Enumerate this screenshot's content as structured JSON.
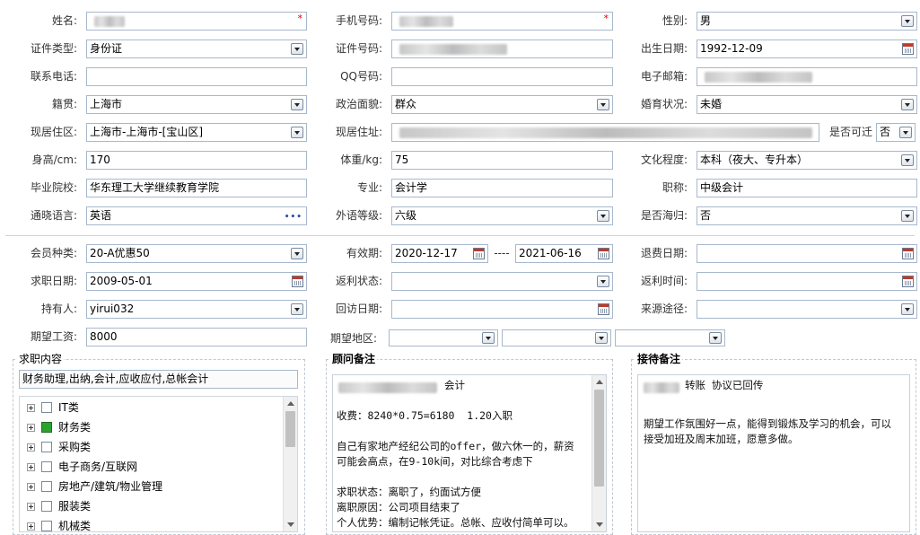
{
  "row1": {
    "name_label": "姓名:",
    "phone_label": "手机号码:",
    "gender_label": "性别:",
    "gender_value": "男"
  },
  "row2": {
    "idtype_label": "证件类型:",
    "idtype_value": "身份证",
    "idno_label": "证件号码:",
    "birth_label": "出生日期:",
    "birth_value": "1992-12-09"
  },
  "row3": {
    "tel_label": "联系电话:",
    "qq_label": "QQ号码:",
    "email_label": "电子邮箱:"
  },
  "row4": {
    "native_label": "籍贯:",
    "native_value": "上海市",
    "political_label": "政治面貌:",
    "political_value": "群众",
    "marital_label": "婚育状况:",
    "marital_value": "未婚"
  },
  "row5": {
    "area_label": "现居住区:",
    "area_value": "上海市-上海市-[宝山区]",
    "address_label": "现居住址:",
    "relocate_label": "是否可迁",
    "relocate_value": "否"
  },
  "row6": {
    "height_label": "身高/cm:",
    "height_value": "170",
    "weight_label": "体重/kg:",
    "weight_value": "75",
    "edu_label": "文化程度:",
    "edu_value": "本科（夜大、专升本）"
  },
  "row7": {
    "school_label": "毕业院校:",
    "school_value": "华东理工大学继续教育学院",
    "major_label": "专业:",
    "major_value": "会计学",
    "title_label": "职称:",
    "title_value": "中级会计"
  },
  "row8": {
    "lang_label": "通晓语言:",
    "lang_value": "英语",
    "lang_btn": "•••",
    "level_label": "外语等级:",
    "level_value": "六级",
    "overseas_label": "是否海归:",
    "overseas_value": "否"
  },
  "row9": {
    "member_label": "会员种类:",
    "member_value": "20-A优惠50",
    "valid_label": "有效期:",
    "valid_from": "2020-12-17",
    "valid_sep": "----",
    "valid_to": "2021-06-16",
    "refund_label": "退费日期:"
  },
  "row10": {
    "jobdate_label": "求职日期:",
    "jobdate_value": "2009-05-01",
    "rebate_label": "返利状态:",
    "rebatetime_label": "返利时间:"
  },
  "row11": {
    "holder_label": "持有人:",
    "holder_value": "yirui032",
    "visit_label": "回访日期:",
    "source_label": "来源途径:"
  },
  "row12": {
    "salary_label": "期望工资:",
    "salary_value": "8000",
    "region_label": "期望地区:"
  },
  "job": {
    "title": "求职内容",
    "summary": "财务助理,出纳,会计,应收应付,总帐会计",
    "tree": [
      {
        "label": "IT类",
        "checked": false
      },
      {
        "label": "财务类",
        "checked": true
      },
      {
        "label": "采购类",
        "checked": false
      },
      {
        "label": "电子商务/互联网",
        "checked": false
      },
      {
        "label": "房地产/建筑/物业管理",
        "checked": false
      },
      {
        "label": "服装类",
        "checked": false
      },
      {
        "label": "机械类",
        "checked": false
      }
    ]
  },
  "advisor": {
    "title": "顾问备注",
    "line1_suffix": "会计",
    "text": "收费：8240*0.75=6180  1.20入职\n\n自己有家地产经纪公司的offer，做六休一的，薪资\n可能会高点，在9-10k间，对比综合考虑下\n\n求职状态：离职了，约面试方便\n离职原因：公司项目结束了\n个人优势：编制记帐凭证。总帐、应收付简单可以。"
  },
  "reception": {
    "title": "接待备注",
    "line1_suffix": "转账 协议已回传",
    "text": "期望工作氛围好一点，能得到锻炼及学习的机会，可以\n接受加班及周末加班，愿意多做。"
  },
  "colors": {
    "border": "#a8b8cc",
    "required": "#dd0000",
    "checked": "#2ea22e"
  }
}
